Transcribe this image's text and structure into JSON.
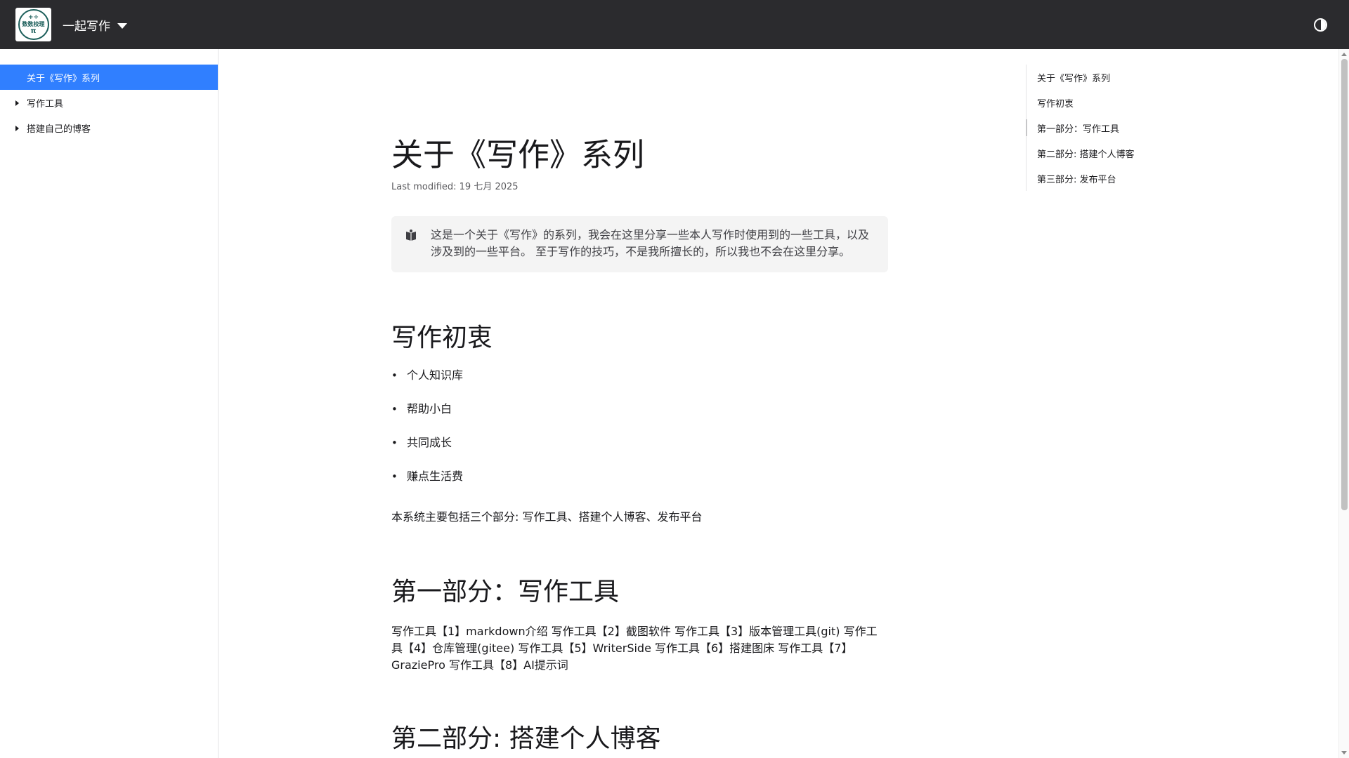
{
  "header": {
    "logo_text_top": "+÷",
    "logo_text_mid": "数数校理",
    "logo_text_pi": "π",
    "site_title": "一起写作",
    "theme_toggle_icon": "contrast-icon"
  },
  "sidebar": {
    "items": [
      {
        "label": "关于《写作》系列",
        "active": true
      },
      {
        "label": "写作工具",
        "expandable": true
      },
      {
        "label": "搭建自己的博客",
        "expandable": true
      }
    ]
  },
  "article": {
    "title": "关于《写作》系列",
    "last_modified": "Last modified: 19 七月 2025",
    "note_text": "这是一个关于《写作》的系列，我会在这里分享一些本人写作时使用到的一些工具，以及涉及到的一些平台。 至于写作的技巧，不是我所擅长的，所以我也不会在这里分享。",
    "section1_title": "写作初衷",
    "bullets": [
      "个人知识库",
      "帮助小白",
      "共同成长",
      "赚点生活费"
    ],
    "summary": "本系统主要包括三个部分: 写作工具、搭建个人博客、发布平台",
    "section2_title": "第一部分：写作工具",
    "tools_text": "写作工具【1】markdown介绍 写作工具【2】截图软件 写作工具【3】版本管理工具(git) 写作工具【4】仓库管理(gitee) 写作工具【5】WriterSide 写作工具【6】搭建图床 写作工具【7】GraziePro 写作工具【8】AI提示词",
    "section3_title": "第二部分: 搭建个人博客"
  },
  "toc": {
    "items": [
      "关于《写作》系列",
      "写作初衷",
      "第一部分：写作工具",
      "第二部分: 搭建个人博客",
      "第三部分: 发布平台"
    ]
  },
  "colors": {
    "header_bg": "#2b2b2e",
    "active_item": "#307fff",
    "note_bg": "#f4f4f4"
  }
}
